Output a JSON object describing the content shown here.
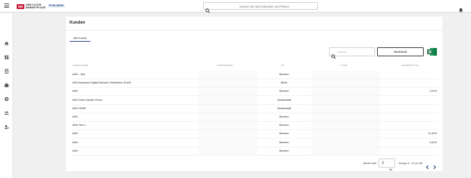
{
  "header": {
    "logo_text_line1": "ADN CLOUD",
    "logo_text_line2": "MARKETPLACE",
    "plan_badge": "PLAN | BASIC",
    "search_placeholder": "Suchen Sie nach Diensten und Plänen"
  },
  "sidebar": {
    "items": [
      {
        "icon": "home-icon"
      },
      {
        "icon": "dashboard-icon"
      },
      {
        "icon": "document-icon"
      },
      {
        "icon": "briefcase-icon"
      },
      {
        "icon": "support-icon"
      },
      {
        "icon": "users-icon"
      },
      {
        "icon": "user-settings-icon"
      }
    ]
  },
  "page": {
    "title": "Kunden",
    "tab_label": "Alle Kunde",
    "search_placeholder": "Suchen",
    "new_button": "Neukunde",
    "excel_icon": "excel-icon"
  },
  "table": {
    "headers": [
      "Customer Name",
      "Kundennummer",
      "Ort",
      "E-Mail",
      "monatlicher Preis"
    ],
    "rows": [
      {
        "name": "ADN - Test",
        "kd": "",
        "ort": "Bochum",
        "email": "",
        "preis": ""
      },
      {
        "name": "ADN Advanced Digital Network Distribution GmbH",
        "kd": "",
        "ort": "Berlin",
        "email": "",
        "preis": ""
      },
      {
        "name": "ADN",
        "kd": "",
        "ort": "Bochum",
        "email": "",
        "preis": "0,00 €"
      },
      {
        "name": "ADN Demo Muster Firma",
        "kd": "",
        "ort": "Musterstadt",
        "email": "",
        "preis": ""
      },
      {
        "name": "ADN ODAP",
        "kd": "",
        "ort": "Musterstadt",
        "email": "",
        "preis": ""
      },
      {
        "name": "ADN",
        "kd": "",
        "ort": "Bochum",
        "email": "",
        "preis": ""
      },
      {
        "name": "ADN Test 1",
        "kd": "",
        "ort": "Bochum",
        "email": "",
        "preis": ""
      },
      {
        "name": "ADN",
        "kd": "",
        "ort": "Bochum",
        "email": "",
        "preis": "21,60 €"
      },
      {
        "name": "ADN",
        "kd": "",
        "ort": "Bochum",
        "email": "",
        "preis": "0,00 €"
      },
      {
        "name": "ADN",
        "kd": "",
        "ort": "Bochum",
        "email": "",
        "preis": ""
      }
    ]
  },
  "pagination": {
    "label": "aktuelle Seite",
    "page": "2",
    "range": "Anzeige 11 - 20 von 286"
  },
  "colors": {
    "accent": "#1d3f7a",
    "brand_red": "#c8102e",
    "excel_green": "#1e7145"
  }
}
